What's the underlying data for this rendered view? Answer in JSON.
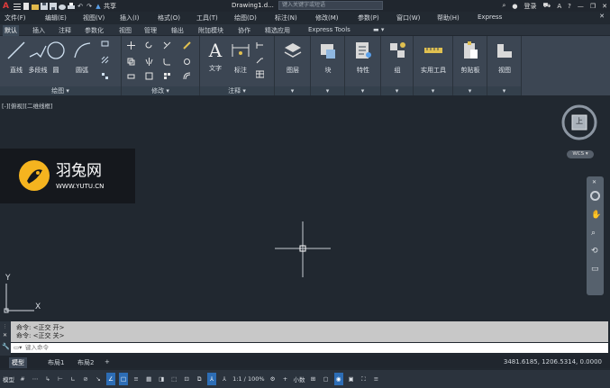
{
  "titlebar": {
    "share_label": "共享",
    "document_title": "Drawing1.d...",
    "search_placeholder": "键入关键字或短语",
    "login_label": "登录"
  },
  "menubar": {
    "items": [
      "文件(F)",
      "编辑(E)",
      "视图(V)",
      "插入(I)",
      "格式(O)",
      "工具(T)",
      "绘图(D)",
      "标注(N)",
      "修改(M)",
      "参数(P)",
      "窗口(W)",
      "帮助(H)",
      "Express"
    ]
  },
  "ribbon_tabs": {
    "items": [
      "默认",
      "插入",
      "注释",
      "参数化",
      "视图",
      "管理",
      "输出",
      "附加模块",
      "协作",
      "精选应用",
      "Express Tools"
    ],
    "active_index": 0
  },
  "ribbon": {
    "draw_panel": {
      "label": "绘图",
      "line": "直线",
      "polyline": "多段线",
      "circle": "圆",
      "arc": "圆弧"
    },
    "modify_panel": {
      "label": "修改"
    },
    "annotation_panel": {
      "label": "注释",
      "text": "文字",
      "dimension": "标注"
    },
    "layers": {
      "label": "图层"
    },
    "block": {
      "label": "块"
    },
    "properties": {
      "label": "特性"
    },
    "groups": {
      "label": "组"
    },
    "utilities": {
      "label": "实用工具"
    },
    "clipboard": {
      "label": "剪贴板"
    },
    "view": {
      "label": "视图"
    }
  },
  "viewport": {
    "label": "[-][俯视][二维线框]",
    "ucs_y": "Y",
    "ucs_x": "X",
    "viewcube_face": "上",
    "wcs_label": "WCS"
  },
  "watermark": {
    "name": "羽兔网",
    "url": "WWW.YUTU.CN"
  },
  "command": {
    "history_1": "命令:  <正交 开>",
    "history_2": "命令:  <正交 关>",
    "prompt_placeholder": "键入命令"
  },
  "layout_tabs": {
    "items": [
      "模型",
      "布局1",
      "布局2"
    ],
    "add": "+",
    "active_index": 0
  },
  "status": {
    "coords": "3481.6185, 1206.5314, 0.0000",
    "model_label": "模型",
    "scale": "1:1 / 100%",
    "units": "小数"
  },
  "colors": {
    "accent": "#2d6db5",
    "background": "#212830",
    "ribbon": "#3c4653",
    "brand_red": "#e03b3b"
  }
}
